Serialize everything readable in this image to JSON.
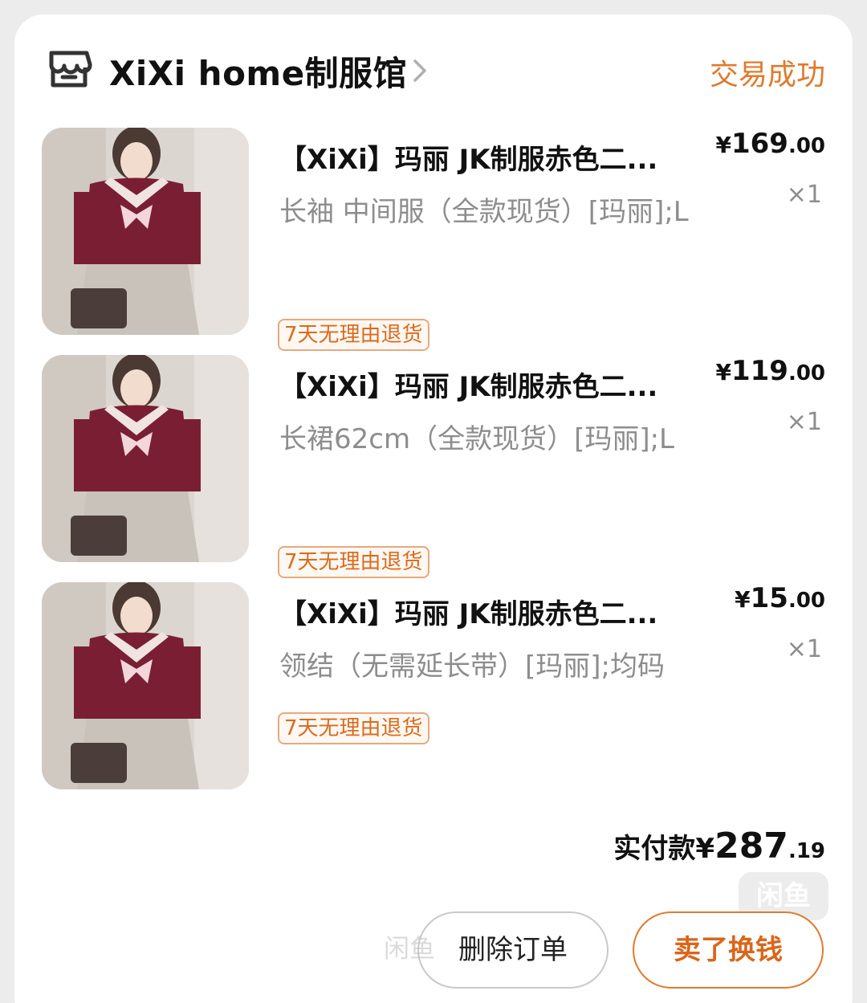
{
  "store": {
    "name": "XiXi home制服馆",
    "status": "交易成功",
    "icon": "store-icon"
  },
  "items": [
    {
      "title": "【XiXi】玛丽 JK制服赤色二...",
      "spec": "长袖 中间服（全款现货）[玛丽];L",
      "price_cur": "¥",
      "price_int": "169",
      "price_dec": ".00",
      "qty": "×1",
      "badge": "7天无理由退货"
    },
    {
      "title": "【XiXi】玛丽 JK制服赤色二...",
      "spec": "长裙62cm（全款现货）[玛丽];L",
      "price_cur": "¥",
      "price_int": "119",
      "price_dec": ".00",
      "qty": "×1",
      "badge": "7天无理由退货"
    },
    {
      "title": "【XiXi】玛丽 JK制服赤色二...",
      "spec": "领结（无需延长带）[玛丽];均码",
      "price_cur": "¥",
      "price_int": "15",
      "price_dec": ".00",
      "qty": "×1",
      "badge": "7天无理由退货"
    }
  ],
  "summary": {
    "label": "实付款",
    "cur": "¥",
    "amount_int": "287",
    "amount_dec": ".19"
  },
  "actions": {
    "delete_label": "删除订单",
    "resell_label": "卖了换钱"
  },
  "watermark": {
    "badge": "闲鱼",
    "text": "闲鱼"
  },
  "colors": {
    "accent": "#e07a2e",
    "badge_border": "#e8a87d",
    "muted_text": "#8d8d8d"
  }
}
